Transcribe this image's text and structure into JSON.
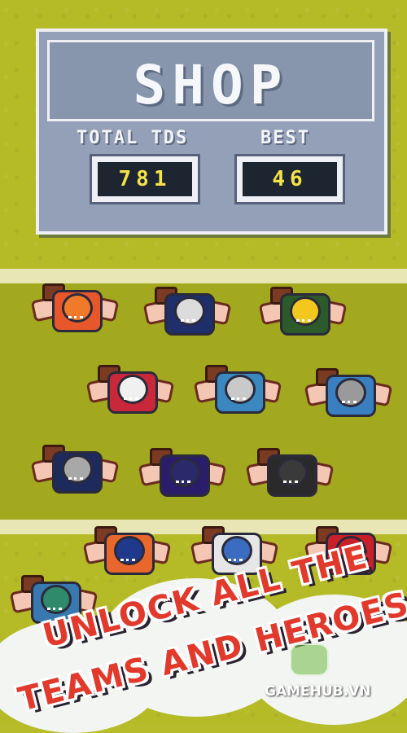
{
  "shop": {
    "title": "SHOP",
    "total_label": "TOTAL TDS",
    "total_value": "781",
    "best_label": "BEST",
    "best_value": "46"
  },
  "players": [
    {
      "name": "player-orange",
      "jersey": "#e8572c",
      "helmet": "#f07a2a"
    },
    {
      "name": "player-navy",
      "jersey": "#1f2f6b",
      "helmet": "#dcdcdc"
    },
    {
      "name": "player-green-gold",
      "jersey": "#2c5a2a",
      "helmet": "#f2c81e"
    },
    {
      "name": "player-red-white",
      "jersey": "#c8283a",
      "helmet": "#f0f0f0"
    },
    {
      "name": "player-lightblue",
      "jersey": "#3b88c0",
      "helmet": "#c9c9c9"
    },
    {
      "name": "player-blue-grey",
      "jersey": "#3a7fc0",
      "helmet": "#9a9a9a"
    },
    {
      "name": "player-navy-silver",
      "jersey": "#1d2b5c",
      "helmet": "#a8a8a8"
    },
    {
      "name": "player-purple",
      "jersey": "#2a1d6b",
      "helmet": "#2a2a6b"
    },
    {
      "name": "player-black-gold",
      "jersey": "#2a2a2a",
      "helmet": "#3a3a3a"
    },
    {
      "name": "player-orange-blue",
      "jersey": "#e8672c",
      "helmet": "#1f3a8c"
    },
    {
      "name": "player-white-blue",
      "jersey": "#e6e6e6",
      "helmet": "#3a6cc0"
    },
    {
      "name": "player-red",
      "jersey": "#c8202a",
      "helmet": "#c8202a"
    },
    {
      "name": "player-teal",
      "jersey": "#3a78b0",
      "helmet": "#2f8a6b"
    }
  ],
  "promo": {
    "line1": "UNLOCK ALL THE",
    "line2": "TEAMS AND HEROES!"
  },
  "watermark": "GAMEHUB.VN"
}
